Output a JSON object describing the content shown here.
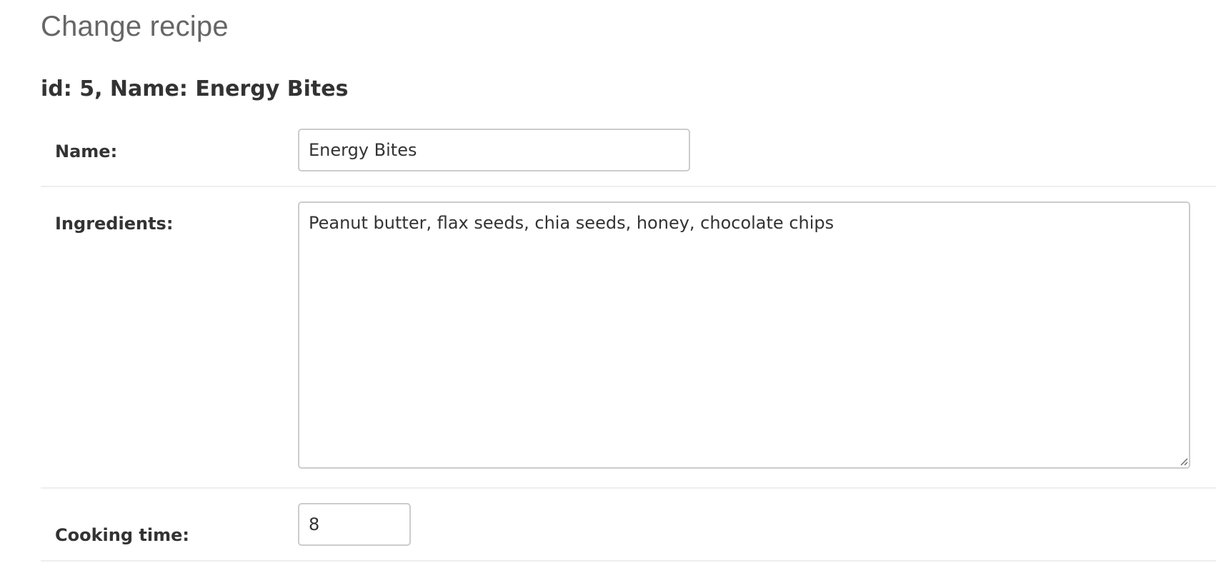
{
  "page": {
    "title": "Change recipe",
    "record_heading": "id: 5, Name: Energy Bites"
  },
  "form": {
    "name": {
      "label": "Name:",
      "value": "Energy Bites"
    },
    "ingredients": {
      "label": "Ingredients:",
      "value": "Peanut butter, flax seeds, chia seeds, honey, chocolate chips"
    },
    "cooking_time": {
      "label": "Cooking time:",
      "value": "8"
    }
  },
  "icons": {
    "textarea_resize": "resize-grip-icon"
  }
}
